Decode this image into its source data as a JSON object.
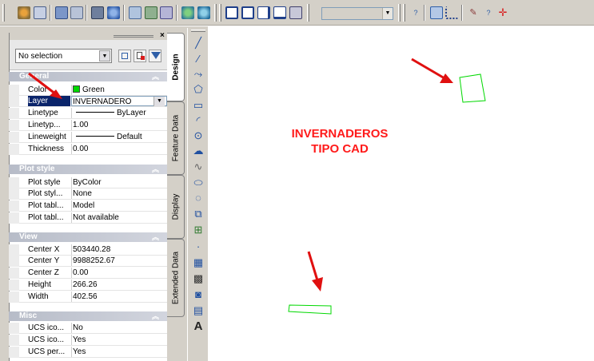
{
  "toolbar": {
    "style_combo_value": ""
  },
  "palette": {
    "selection_combo": "No selection",
    "sections": {
      "general": {
        "title": "General",
        "rows": [
          {
            "label": "Color",
            "value": "Green"
          },
          {
            "label": "Layer",
            "value": "INVERNADERO"
          },
          {
            "label": "Linetype",
            "value": "ByLayer"
          },
          {
            "label": "Linetyp...",
            "value": "1.00"
          },
          {
            "label": "Lineweight",
            "value": "Default"
          },
          {
            "label": "Thickness",
            "value": "0.00"
          }
        ]
      },
      "plot_style": {
        "title": "Plot style",
        "rows": [
          {
            "label": "Plot style",
            "value": "ByColor"
          },
          {
            "label": "Plot styl...",
            "value": "None"
          },
          {
            "label": "Plot tabl...",
            "value": "Model"
          },
          {
            "label": "Plot tabl...",
            "value": "Not available"
          }
        ]
      },
      "view": {
        "title": "View",
        "rows": [
          {
            "label": "Center X",
            "value": "503440.28"
          },
          {
            "label": "Center Y",
            "value": "9988252.67"
          },
          {
            "label": "Center Z",
            "value": "0.00"
          },
          {
            "label": "Height",
            "value": "266.26"
          },
          {
            "label": "Width",
            "value": "402.56"
          }
        ]
      },
      "misc": {
        "title": "Misc",
        "rows": [
          {
            "label": "UCS ico...",
            "value": "No"
          },
          {
            "label": "UCS ico...",
            "value": "Yes"
          },
          {
            "label": "UCS per...",
            "value": "Yes"
          }
        ]
      }
    }
  },
  "tabs": [
    "Design",
    "Feature Data",
    "Display",
    "Extended Data"
  ],
  "canvas": {
    "title_line1": "INVERNADEROS",
    "title_line2": "TIPO CAD"
  },
  "colors": {
    "annotation_red": "#ff1a1a",
    "polygon_green": "#00d800",
    "selection_blue": "#0a246a"
  },
  "icons": {
    "draw_tools": [
      "line-icon",
      "construction-line-icon",
      "polyline-icon",
      "polygon-icon",
      "rectangle-icon",
      "arc-icon",
      "circle-icon",
      "revision-cloud-icon",
      "spline-icon",
      "ellipse-icon",
      "ellipse-arc-icon",
      "insert-block-icon",
      "make-block-icon",
      "point-icon",
      "hatch-icon",
      "gradient-icon",
      "region-icon",
      "table-icon",
      "multiline-text-icon"
    ]
  }
}
